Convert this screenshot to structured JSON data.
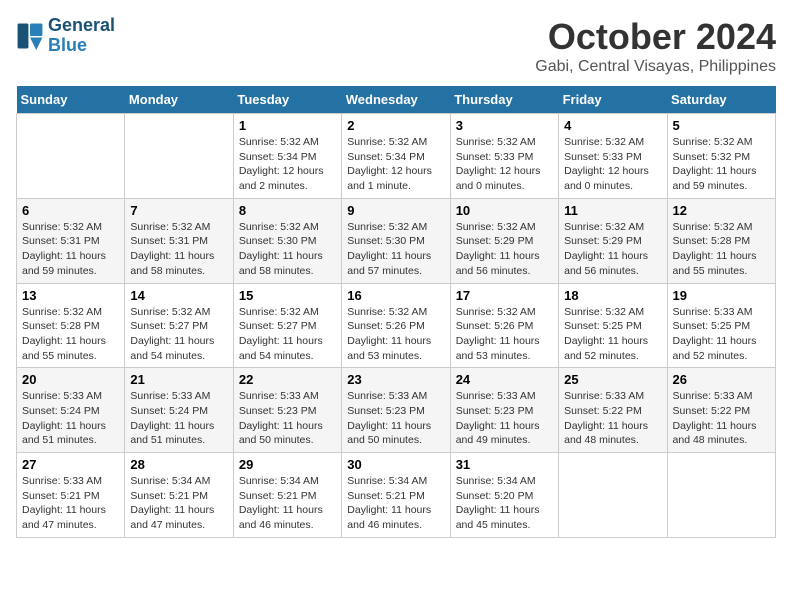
{
  "header": {
    "logo_line1": "General",
    "logo_line2": "Blue",
    "month": "October 2024",
    "location": "Gabi, Central Visayas, Philippines"
  },
  "weekdays": [
    "Sunday",
    "Monday",
    "Tuesday",
    "Wednesday",
    "Thursday",
    "Friday",
    "Saturday"
  ],
  "weeks": [
    [
      {
        "day": "",
        "info": ""
      },
      {
        "day": "",
        "info": ""
      },
      {
        "day": "1",
        "info": "Sunrise: 5:32 AM\nSunset: 5:34 PM\nDaylight: 12 hours\nand 2 minutes."
      },
      {
        "day": "2",
        "info": "Sunrise: 5:32 AM\nSunset: 5:34 PM\nDaylight: 12 hours\nand 1 minute."
      },
      {
        "day": "3",
        "info": "Sunrise: 5:32 AM\nSunset: 5:33 PM\nDaylight: 12 hours\nand 0 minutes."
      },
      {
        "day": "4",
        "info": "Sunrise: 5:32 AM\nSunset: 5:33 PM\nDaylight: 12 hours\nand 0 minutes."
      },
      {
        "day": "5",
        "info": "Sunrise: 5:32 AM\nSunset: 5:32 PM\nDaylight: 11 hours\nand 59 minutes."
      }
    ],
    [
      {
        "day": "6",
        "info": "Sunrise: 5:32 AM\nSunset: 5:31 PM\nDaylight: 11 hours\nand 59 minutes."
      },
      {
        "day": "7",
        "info": "Sunrise: 5:32 AM\nSunset: 5:31 PM\nDaylight: 11 hours\nand 58 minutes."
      },
      {
        "day": "8",
        "info": "Sunrise: 5:32 AM\nSunset: 5:30 PM\nDaylight: 11 hours\nand 58 minutes."
      },
      {
        "day": "9",
        "info": "Sunrise: 5:32 AM\nSunset: 5:30 PM\nDaylight: 11 hours\nand 57 minutes."
      },
      {
        "day": "10",
        "info": "Sunrise: 5:32 AM\nSunset: 5:29 PM\nDaylight: 11 hours\nand 56 minutes."
      },
      {
        "day": "11",
        "info": "Sunrise: 5:32 AM\nSunset: 5:29 PM\nDaylight: 11 hours\nand 56 minutes."
      },
      {
        "day": "12",
        "info": "Sunrise: 5:32 AM\nSunset: 5:28 PM\nDaylight: 11 hours\nand 55 minutes."
      }
    ],
    [
      {
        "day": "13",
        "info": "Sunrise: 5:32 AM\nSunset: 5:28 PM\nDaylight: 11 hours\nand 55 minutes."
      },
      {
        "day": "14",
        "info": "Sunrise: 5:32 AM\nSunset: 5:27 PM\nDaylight: 11 hours\nand 54 minutes."
      },
      {
        "day": "15",
        "info": "Sunrise: 5:32 AM\nSunset: 5:27 PM\nDaylight: 11 hours\nand 54 minutes."
      },
      {
        "day": "16",
        "info": "Sunrise: 5:32 AM\nSunset: 5:26 PM\nDaylight: 11 hours\nand 53 minutes."
      },
      {
        "day": "17",
        "info": "Sunrise: 5:32 AM\nSunset: 5:26 PM\nDaylight: 11 hours\nand 53 minutes."
      },
      {
        "day": "18",
        "info": "Sunrise: 5:32 AM\nSunset: 5:25 PM\nDaylight: 11 hours\nand 52 minutes."
      },
      {
        "day": "19",
        "info": "Sunrise: 5:33 AM\nSunset: 5:25 PM\nDaylight: 11 hours\nand 52 minutes."
      }
    ],
    [
      {
        "day": "20",
        "info": "Sunrise: 5:33 AM\nSunset: 5:24 PM\nDaylight: 11 hours\nand 51 minutes."
      },
      {
        "day": "21",
        "info": "Sunrise: 5:33 AM\nSunset: 5:24 PM\nDaylight: 11 hours\nand 51 minutes."
      },
      {
        "day": "22",
        "info": "Sunrise: 5:33 AM\nSunset: 5:23 PM\nDaylight: 11 hours\nand 50 minutes."
      },
      {
        "day": "23",
        "info": "Sunrise: 5:33 AM\nSunset: 5:23 PM\nDaylight: 11 hours\nand 50 minutes."
      },
      {
        "day": "24",
        "info": "Sunrise: 5:33 AM\nSunset: 5:23 PM\nDaylight: 11 hours\nand 49 minutes."
      },
      {
        "day": "25",
        "info": "Sunrise: 5:33 AM\nSunset: 5:22 PM\nDaylight: 11 hours\nand 48 minutes."
      },
      {
        "day": "26",
        "info": "Sunrise: 5:33 AM\nSunset: 5:22 PM\nDaylight: 11 hours\nand 48 minutes."
      }
    ],
    [
      {
        "day": "27",
        "info": "Sunrise: 5:33 AM\nSunset: 5:21 PM\nDaylight: 11 hours\nand 47 minutes."
      },
      {
        "day": "28",
        "info": "Sunrise: 5:34 AM\nSunset: 5:21 PM\nDaylight: 11 hours\nand 47 minutes."
      },
      {
        "day": "29",
        "info": "Sunrise: 5:34 AM\nSunset: 5:21 PM\nDaylight: 11 hours\nand 46 minutes."
      },
      {
        "day": "30",
        "info": "Sunrise: 5:34 AM\nSunset: 5:21 PM\nDaylight: 11 hours\nand 46 minutes."
      },
      {
        "day": "31",
        "info": "Sunrise: 5:34 AM\nSunset: 5:20 PM\nDaylight: 11 hours\nand 45 minutes."
      },
      {
        "day": "",
        "info": ""
      },
      {
        "day": "",
        "info": ""
      }
    ]
  ]
}
